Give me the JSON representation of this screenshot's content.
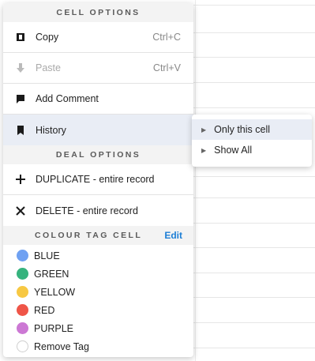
{
  "menu": {
    "cell_options_header": "CELL OPTIONS",
    "copy": {
      "label": "Copy",
      "shortcut": "Ctrl+C",
      "icon": "copy-icon"
    },
    "paste": {
      "label": "Paste",
      "shortcut": "Ctrl+V",
      "icon": "paste-icon",
      "disabled": true
    },
    "add_comment": {
      "label": "Add Comment",
      "icon": "comment-icon"
    },
    "history": {
      "label": "History",
      "icon": "bookmark-icon"
    },
    "deal_options_header": "DEAL OPTIONS",
    "duplicate": {
      "label": "DUPLICATE - entire record",
      "icon": "plus-icon"
    },
    "delete": {
      "label": "DELETE - entire record",
      "icon": "close-icon"
    },
    "colour_tag_header": "COLOUR TAG CELL",
    "edit_label": "Edit",
    "tags": [
      {
        "label": "BLUE",
        "color": "#6fa1f2"
      },
      {
        "label": "GREEN",
        "color": "#36b37e"
      },
      {
        "label": "YELLOW",
        "color": "#f7c843"
      },
      {
        "label": "RED",
        "color": "#ef5548"
      },
      {
        "label": "PURPLE",
        "color": "#cc78d4"
      },
      {
        "label": "Remove Tag",
        "color": "#ffffff"
      }
    ]
  },
  "submenu": {
    "items": [
      {
        "label": "Only this cell"
      },
      {
        "label": "Show All"
      }
    ]
  }
}
